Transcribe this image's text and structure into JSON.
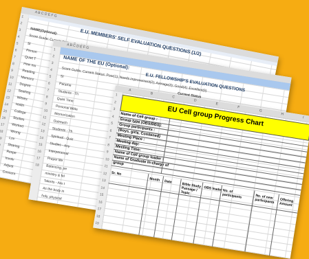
{
  "sheet1": {
    "col_letters": "A    B    C D E F G",
    "title": "E.U. MEMBERS' SELF EVALUATION QUESTIONS (1/2)",
    "name_label": "NAME(Optional):",
    "score_guide": "Score Guide: Current Status: Poor(1); Needs improvement(2); Average(3); Good(4); Excellent(5)",
    "rows": [
      "Sl",
      "Person",
      "Quiet T",
      "How mu",
      "Reading",
      "Memoriz",
      "Degree",
      "Seeking",
      "Witnes",
      "Holiln",
      "College",
      "Studies",
      "Worked",
      "Wrong",
      "Lov",
      "Sharing",
      "Respe",
      "Involv",
      "Adjust",
      "Concern"
    ],
    "row_numbers": [
      "1",
      "2",
      "3",
      "4",
      "5",
      "6",
      "7",
      "8",
      "9",
      "10",
      "11",
      "12",
      "13",
      "14",
      "15",
      "16",
      "17",
      "18",
      "19",
      "20"
    ]
  },
  "sheet2": {
    "col_letters": "A    B    C D E F G",
    "title": "NAME OF THE EU (Optional):",
    "subtitle": "E.U. FELLOWSHIP'S EVALUATION QUESTIONS",
    "score_guide": "Score Guide: Current Status: Poor(1); Needs improvement(2); Average(3); Good(4); Excellent(5)",
    "current_status": "Current Status",
    "rows": [
      "SI",
      "Parame",
      "Students - Th",
      "Quiet Time",
      "Personal Bible",
      "Memorization",
      "Outreach",
      "Students - Th",
      "Spiritual - Quiz",
      "Studies - Any",
      "Interpersonal",
      "Prayer life",
      "Balancing, pe",
      "ministry & fel",
      "Talents - Are t",
      "As the body in",
      "holy, physical"
    ],
    "row_numbers": [
      "1",
      "2",
      "3",
      "4",
      "5",
      "6",
      "7",
      "8",
      "9",
      "10",
      "11",
      "12",
      "13",
      "14",
      "15",
      "16",
      "17",
      "18"
    ]
  },
  "sheet3": {
    "col_letters": [
      "A",
      "B",
      "C",
      "D",
      "E",
      "F",
      "G",
      "H",
      "I"
    ],
    "title": "EU Cell group Progress Chart",
    "fields": [
      "Name of Cell group :",
      "Group type (OBS/BBS):",
      "Group participants :",
      "(Boys, girls, Combined)",
      "Meeting Place :",
      "Meeting day:",
      "Meeting Time:",
      "Name of Cell group leader :",
      "Name of Graduate In-charge of",
      "group"
    ],
    "table_headers": [
      "Sr. No",
      "Month",
      "Date",
      "Bible Study Passage / Topic",
      "OBS leader",
      "No. of participants",
      "No. of new participants",
      "Offering Amount"
    ],
    "row_numbers": [
      "1",
      "2",
      "3",
      "4",
      "5",
      "6",
      "7",
      "8",
      "9",
      "10",
      "11",
      "12",
      "13",
      "14",
      "15",
      "16",
      "17",
      "18",
      "19"
    ]
  }
}
